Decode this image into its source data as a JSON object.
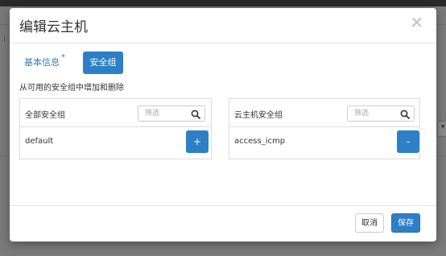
{
  "background": {
    "fragment": "i"
  },
  "modal": {
    "title": "编辑云主机",
    "close_symbol": "×"
  },
  "tabs": [
    {
      "label": "基本信息",
      "required_mark": "*",
      "active": false
    },
    {
      "label": "安全组",
      "active": true
    }
  ],
  "instruction": "从可用的安全组中增加和删除",
  "available_panel": {
    "title": "全部安全组",
    "filter_placeholder": "筛选",
    "items": [
      {
        "name": "default",
        "action_label": "+"
      }
    ]
  },
  "selected_panel": {
    "title": "云主机安全组",
    "filter_placeholder": "筛选",
    "items": [
      {
        "name": "access_icmp",
        "action_label": "-"
      }
    ]
  },
  "footer": {
    "cancel_label": "取消",
    "save_label": "保存"
  },
  "colors": {
    "primary": "#2d7fc6",
    "link": "#337ab7",
    "overlay": "#7a7a7a"
  }
}
